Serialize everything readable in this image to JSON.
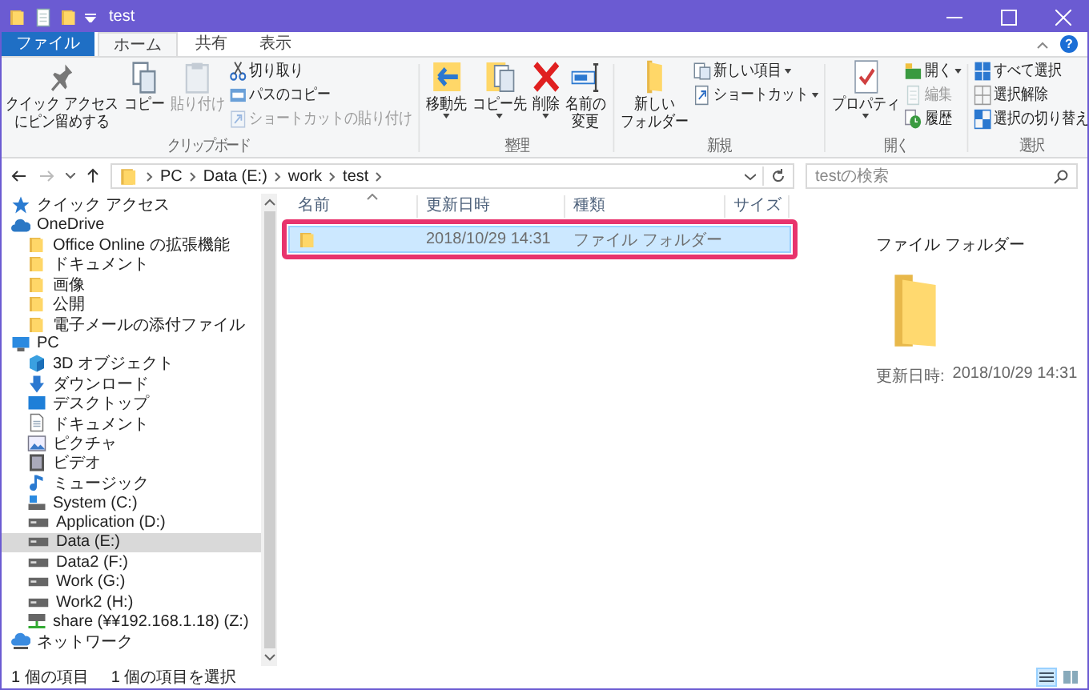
{
  "window": {
    "title": "test"
  },
  "ribbon_tabs": [
    {
      "label": "ファイル",
      "kind": "file",
      "selected": false
    },
    {
      "label": "ホーム",
      "kind": "tab",
      "selected": true
    },
    {
      "label": "共有",
      "kind": "tab",
      "selected": false
    },
    {
      "label": "表示",
      "kind": "tab",
      "selected": false
    }
  ],
  "help_button": "?",
  "ribbon_groups": [
    {
      "label": "クリップボード",
      "items": [
        {
          "kind": "large",
          "lines": [
            "クイック アクセス",
            "にピン留めする"
          ],
          "dropdown": false,
          "disabled": false
        },
        {
          "kind": "large",
          "lines": [
            "コピー"
          ],
          "dropdown": false,
          "disabled": false
        },
        {
          "kind": "large",
          "lines": [
            "貼り付け"
          ],
          "dropdown": false,
          "disabled": true
        },
        {
          "kind": "small",
          "lines": [
            "切り取り"
          ],
          "dropdown": false,
          "disabled": false
        },
        {
          "kind": "small",
          "lines": [
            "パスのコピー"
          ],
          "dropdown": false,
          "disabled": false
        },
        {
          "kind": "small",
          "lines": [
            "ショートカットの貼り付け"
          ],
          "dropdown": false,
          "disabled": true
        }
      ]
    },
    {
      "label": "整理",
      "items": [
        {
          "kind": "large",
          "lines": [
            "移動先"
          ],
          "dropdown": true,
          "disabled": false
        },
        {
          "kind": "large",
          "lines": [
            "コピー先"
          ],
          "dropdown": true,
          "disabled": false
        },
        {
          "kind": "large",
          "lines": [
            "削除"
          ],
          "dropdown": true,
          "disabled": false
        },
        {
          "kind": "large",
          "lines": [
            "名前の",
            "変更"
          ],
          "dropdown": false,
          "disabled": false
        }
      ]
    },
    {
      "label": "新規",
      "items": [
        {
          "kind": "large",
          "lines": [
            "新しい",
            "フォルダー"
          ],
          "dropdown": false,
          "disabled": false
        },
        {
          "kind": "small",
          "lines": [
            "新しい項目"
          ],
          "dropdown": true,
          "disabled": false
        },
        {
          "kind": "small",
          "lines": [
            "ショートカット"
          ],
          "dropdown": true,
          "disabled": false
        }
      ]
    },
    {
      "label": "開く",
      "items": [
        {
          "kind": "large",
          "lines": [
            "プロパティ"
          ],
          "dropdown": true,
          "disabled": false
        },
        {
          "kind": "small",
          "lines": [
            "開く"
          ],
          "dropdown": true,
          "disabled": false
        },
        {
          "kind": "small",
          "lines": [
            "編集"
          ],
          "dropdown": false,
          "disabled": true
        },
        {
          "kind": "small",
          "lines": [
            "履歴"
          ],
          "dropdown": false,
          "disabled": false
        }
      ]
    },
    {
      "label": "選択",
      "items": [
        {
          "kind": "small",
          "lines": [
            "すべて選択"
          ],
          "dropdown": false,
          "disabled": false
        },
        {
          "kind": "small",
          "lines": [
            "選択解除"
          ],
          "dropdown": false,
          "disabled": false
        },
        {
          "kind": "small",
          "lines": [
            "選択の切り替え"
          ],
          "dropdown": false,
          "disabled": false
        }
      ]
    }
  ],
  "address_bar": {
    "crumbs": [
      "PC",
      "Data (E:)",
      "work",
      "test"
    ]
  },
  "search": {
    "placeholder": "testの検索"
  },
  "nav_tree": [
    {
      "label": "クイック アクセス",
      "selected": false
    },
    {
      "label": "OneDrive",
      "selected": false,
      "children": [
        {
          "label": "Office Online の拡張機能",
          "selected": false
        },
        {
          "label": "ドキュメント",
          "selected": false
        },
        {
          "label": "画像",
          "selected": false
        },
        {
          "label": "公開",
          "selected": false
        },
        {
          "label": "電子メールの添付ファイル",
          "selected": false
        }
      ]
    },
    {
      "label": "PC",
      "selected": false,
      "children": [
        {
          "label": "3D オブジェクト",
          "selected": false
        },
        {
          "label": "ダウンロード",
          "selected": false
        },
        {
          "label": "デスクトップ",
          "selected": false
        },
        {
          "label": "ドキュメント",
          "selected": false
        },
        {
          "label": "ピクチャ",
          "selected": false
        },
        {
          "label": "ビデオ",
          "selected": false
        },
        {
          "label": "ミュージック",
          "selected": false
        },
        {
          "label": "System (C:)",
          "selected": false
        },
        {
          "label": "Application (D:)",
          "selected": false
        },
        {
          "label": "Data (E:)",
          "selected": true
        },
        {
          "label": "Data2 (F:)",
          "selected": false
        },
        {
          "label": "Work (G:)",
          "selected": false
        },
        {
          "label": "Work2 (H:)",
          "selected": false
        },
        {
          "label": "share (¥¥192.168.1.18) (Z:)",
          "selected": false
        }
      ]
    },
    {
      "label": "ネットワーク",
      "selected": false
    }
  ],
  "file_list": {
    "columns": [
      "名前",
      "更新日時",
      "種類",
      "サイズ"
    ],
    "rows": [
      {
        "modified": "2018/10/29 14:31",
        "type": "ファイル フォルダー",
        "selected": true
      }
    ]
  },
  "details_pane": {
    "type": "ファイル フォルダー",
    "modified_label": "更新日時:",
    "modified": "2018/10/29 14:31"
  },
  "status_bar": {
    "item_count": "1 個の項目",
    "selection": "1 個の項目を選択"
  },
  "view_buttons": [
    {
      "selected": true
    },
    {
      "selected": false
    }
  ]
}
